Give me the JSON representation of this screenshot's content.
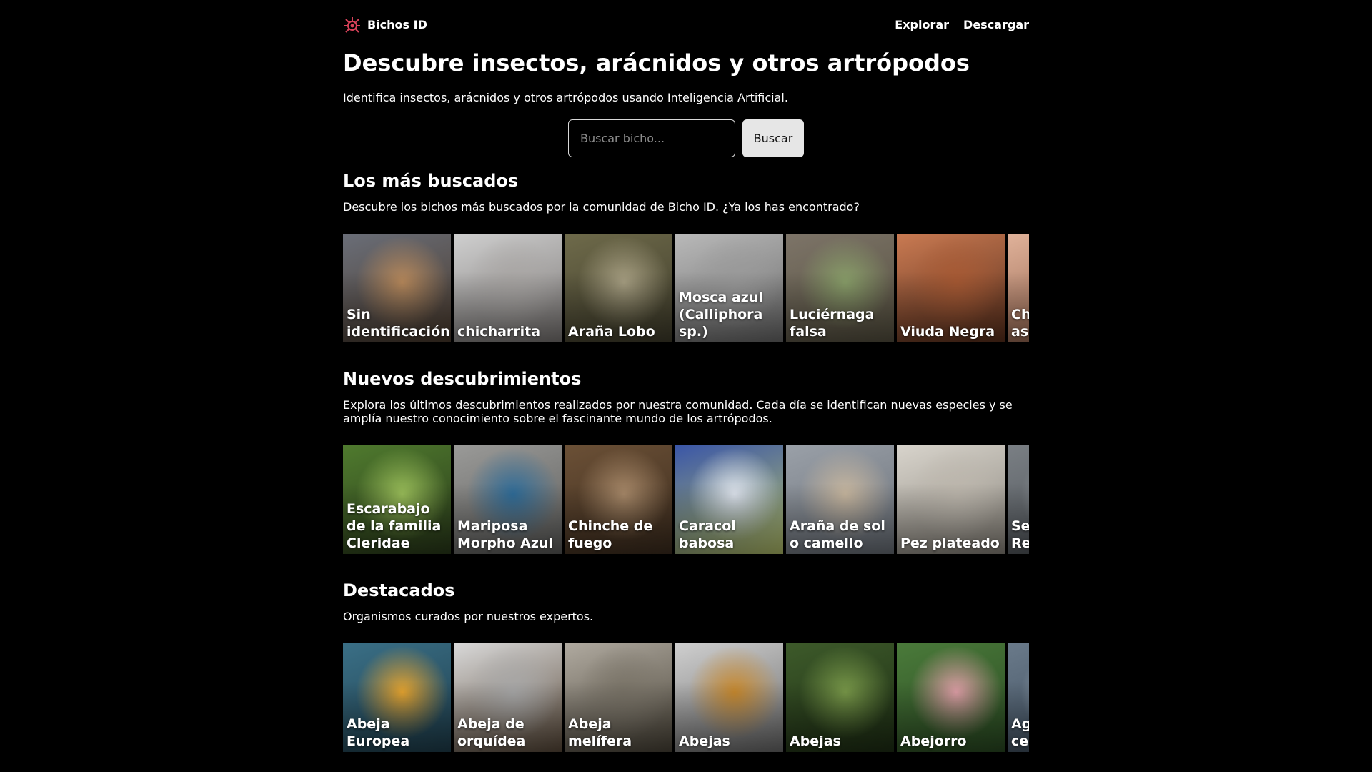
{
  "header": {
    "brand": "Bichos ID",
    "nav": [
      "Explorar",
      "Descargar"
    ]
  },
  "hero": {
    "title": "Descubre insectos, arácnidos y otros artrópodos",
    "subtitle": "Identifica insectos, arácnidos y otros artrópodos usando Inteligencia Artificial.",
    "search_placeholder": "Buscar bicho...",
    "search_button": "Buscar"
  },
  "sections": [
    {
      "title": "Los más buscados",
      "description": "Descubre los bichos más buscados por la comunidad de Bicho ID. ¿Ya los has encontrado?",
      "cards": [
        {
          "label": "Sin identificación",
          "colors": [
            "#6a6e78",
            "#b98a5c",
            "#4a3a2c"
          ]
        },
        {
          "label": "chicharrita",
          "colors": [
            "#cfcfcf",
            "#a9a6a4",
            "#7b7775"
          ]
        },
        {
          "label": "Araña Lobo",
          "colors": [
            "#6e6a4a",
            "#a9a184",
            "#3f3c2b"
          ]
        },
        {
          "label": "Mosca azul (Calliphora sp.)",
          "colors": [
            "#b9b9b9",
            "#9a9a9a",
            "#6a6a6a"
          ]
        },
        {
          "label": "Luciérnaga falsa",
          "colors": [
            "#7d7468",
            "#8aa06a",
            "#55503f"
          ]
        },
        {
          "label": "Viuda Negra",
          "colors": [
            "#c97a52",
            "#a85a34",
            "#5a2f1c"
          ]
        },
        {
          "label": "Chinche asesina",
          "colors": [
            "#e0b29a",
            "#c28a6e",
            "#8a5a44"
          ]
        }
      ]
    },
    {
      "title": "Nuevos descubrimientos",
      "description": "Explora los últimos descubrimientos realizados por nuestra comunidad. Cada día se identifican nuevas especies y se amplía nuestro conocimiento sobre el fascinante mundo de los artrópodos.",
      "cards": [
        {
          "label": "Escarabajo de la familia Cleridae",
          "colors": [
            "#4f7a2e",
            "#9bbf5a",
            "#2a3a1a"
          ]
        },
        {
          "label": "Mariposa Morpho Azul",
          "colors": [
            "#9a9a98",
            "#2f6d9a",
            "#5c5c5a"
          ]
        },
        {
          "label": "Chinche de fuego",
          "colors": [
            "#6b5036",
            "#a98a6a",
            "#3c2c1e"
          ]
        },
        {
          "label": "Caracol babosa",
          "colors": [
            "#3a56a8",
            "#e0e6f0",
            "#b7c36a"
          ]
        },
        {
          "label": "Araña de sol o camello",
          "colors": [
            "#9aa0a8",
            "#c9b8a0",
            "#6a7078"
          ]
        },
        {
          "label": "Pez plateado",
          "colors": [
            "#d8d4cc",
            "#bdb7ad",
            "#8a857c"
          ]
        },
        {
          "label": "Serpiente Real",
          "colors": [
            "#7a7f84",
            "#a0a5aa",
            "#4a4f54"
          ]
        }
      ]
    },
    {
      "title": "Destacados",
      "description": "Organismos curados por nuestros expertos.",
      "cards": [
        {
          "label": "Abeja Europea",
          "colors": [
            "#3a6f86",
            "#e8a630",
            "#1f3e4c"
          ]
        },
        {
          "label": "Abeja de orquídea",
          "colors": [
            "#d9d9d9",
            "#a8a8a8",
            "#5a4a3a"
          ]
        },
        {
          "label": "Abeja melífera",
          "colors": [
            "#b0aaa0",
            "#7a7468",
            "#4a4438"
          ]
        },
        {
          "label": "Abejas",
          "colors": [
            "#cfcfcf",
            "#c98a2e",
            "#6a6a6a"
          ]
        },
        {
          "label": "Abejas",
          "colors": [
            "#3d5a2a",
            "#7a9a4a",
            "#1e2e14"
          ]
        },
        {
          "label": "Abejorro",
          "colors": [
            "#4a7a3a",
            "#e0a0a8",
            "#2a4a22"
          ]
        },
        {
          "label": "Agave centenario",
          "colors": [
            "#6a7a8a",
            "#aab6c0",
            "#3a4a5a"
          ]
        }
      ]
    }
  ],
  "theme": {
    "background": "#000000",
    "text": "#ffffff",
    "accent": "#d9425a"
  },
  "icons": {
    "brand": "bug-icon"
  }
}
